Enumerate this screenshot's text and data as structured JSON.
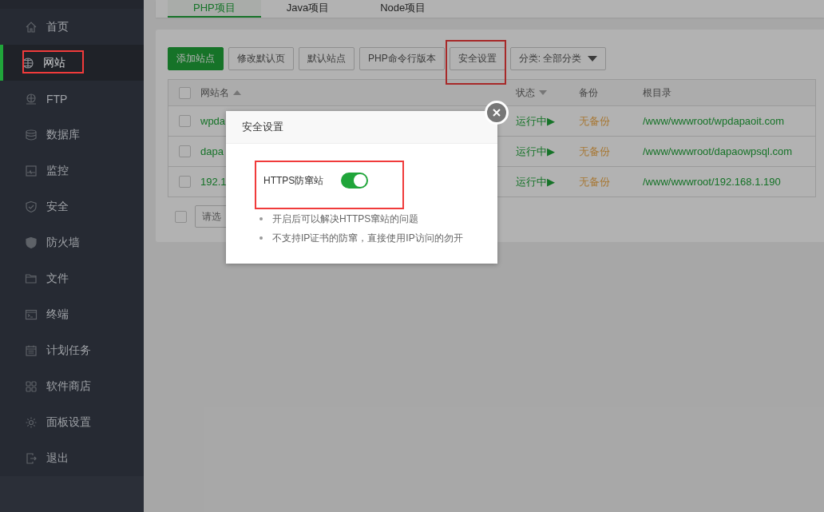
{
  "sidebar": {
    "items": [
      {
        "label": "首页",
        "selected": false,
        "highlighted": false
      },
      {
        "label": "网站",
        "selected": true,
        "highlighted": true
      },
      {
        "label": "FTP",
        "selected": false,
        "highlighted": false
      },
      {
        "label": "数据库",
        "selected": false,
        "highlighted": false
      },
      {
        "label": "监控",
        "selected": false,
        "highlighted": false
      },
      {
        "label": "安全",
        "selected": false,
        "highlighted": false
      },
      {
        "label": "防火墙",
        "selected": false,
        "highlighted": false
      },
      {
        "label": "文件",
        "selected": false,
        "highlighted": false
      },
      {
        "label": "终端",
        "selected": false,
        "highlighted": false
      },
      {
        "label": "计划任务",
        "selected": false,
        "highlighted": false
      },
      {
        "label": "软件商店",
        "selected": false,
        "highlighted": false
      },
      {
        "label": "面板设置",
        "selected": false,
        "highlighted": false
      },
      {
        "label": "退出",
        "selected": false,
        "highlighted": false
      }
    ]
  },
  "tabs": [
    {
      "label": "PHP项目",
      "selected": true
    },
    {
      "label": "Java项目",
      "selected": false
    },
    {
      "label": "Node项目",
      "selected": false
    }
  ],
  "toolbar": {
    "buttons": [
      {
        "label": "添加站点",
        "kind": "primary",
        "highlighted": false
      },
      {
        "label": "修改默认页",
        "kind": "default",
        "highlighted": false
      },
      {
        "label": "默认站点",
        "kind": "default",
        "highlighted": false
      },
      {
        "label": "PHP命令行版本",
        "kind": "default",
        "highlighted": false
      },
      {
        "label": "安全设置",
        "kind": "default",
        "highlighted": true
      }
    ],
    "category": {
      "value": "分类: 全部分类"
    }
  },
  "table": {
    "all_checked": false,
    "columns": [
      "网站名",
      "状态",
      "备份",
      "根目录"
    ],
    "rows": [
      {
        "checked": false,
        "name": "wpda",
        "status": "运行中▶",
        "backup": "无备份",
        "root": "/www/wwwroot/wpdapaoit.com"
      },
      {
        "checked": false,
        "name": "dapa",
        "status": "运行中▶",
        "backup": "无备份",
        "root": "/www/wwwroot/dapaowpsql.com"
      },
      {
        "checked": false,
        "name": "192.1",
        "status": "运行中▶",
        "backup": "无备份",
        "root": "/www/wwwroot/192.168.1.190"
      }
    ],
    "footer": {
      "checked": false,
      "placeholder": "请选"
    }
  },
  "dialog": {
    "title": "安全设置",
    "option": {
      "label": "HTTPS防窜站",
      "on": true,
      "highlighted": true
    },
    "notes": [
      "开启后可以解决HTTPS窜站的问题",
      "不支持IP证书的防窜，直接使用IP访问的勿开"
    ]
  }
}
